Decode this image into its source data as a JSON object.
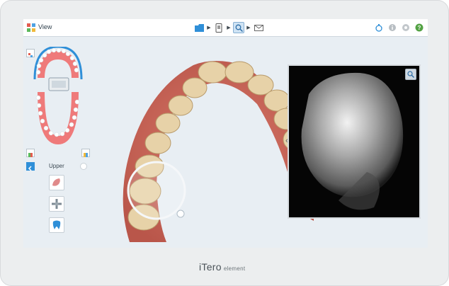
{
  "toolbar": {
    "view_label": "View",
    "workflow_steps": [
      {
        "icon": "folder-icon",
        "active": false
      },
      {
        "icon": "scan-icon",
        "active": false
      },
      {
        "icon": "view-magnifier-icon",
        "active": true
      },
      {
        "icon": "send-icon",
        "active": false
      }
    ],
    "right_icons": [
      "bell-icon",
      "info-icon",
      "settings-icon",
      "help-icon"
    ]
  },
  "left_panel": {
    "jaw_label": "Upper",
    "tools": [
      "tissue-icon",
      "move-icon",
      "tooth-icon"
    ]
  },
  "brand": {
    "name": "iTero",
    "suffix": "element"
  },
  "colors": {
    "accent": "#2f8fd8",
    "help_green": "#53a244",
    "arch_red": "#f06d6d",
    "background": "#e8eef3"
  }
}
